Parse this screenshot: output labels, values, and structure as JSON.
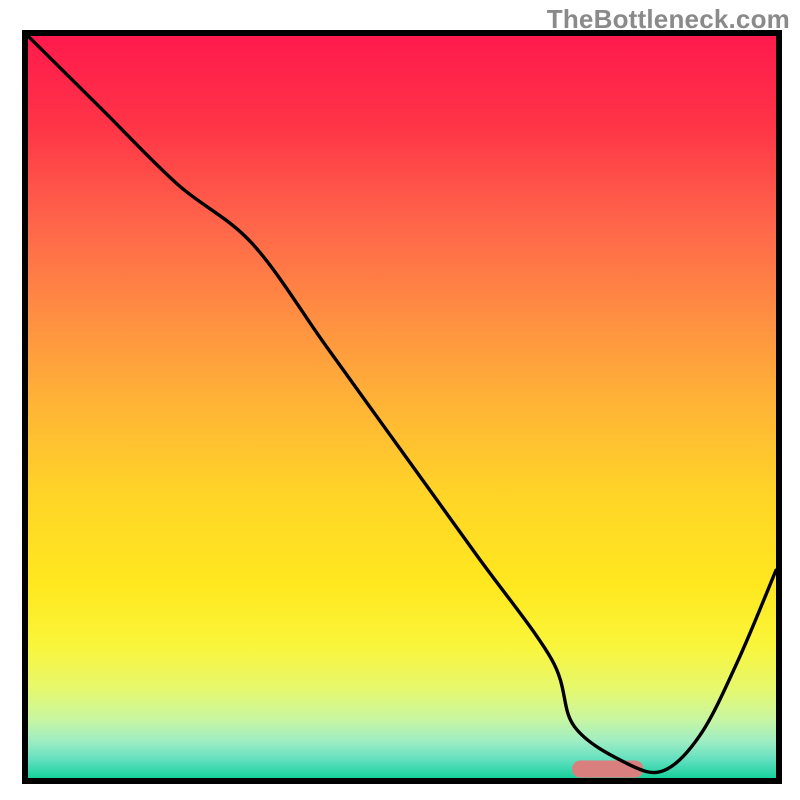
{
  "watermark": "TheBottleneck.com",
  "gradient": {
    "stops": [
      {
        "offset": 0.0,
        "color": "#ff1a4d"
      },
      {
        "offset": 0.12,
        "color": "#ff3447"
      },
      {
        "offset": 0.25,
        "color": "#ff644a"
      },
      {
        "offset": 0.38,
        "color": "#ff8f42"
      },
      {
        "offset": 0.5,
        "color": "#ffb536"
      },
      {
        "offset": 0.62,
        "color": "#ffd527"
      },
      {
        "offset": 0.74,
        "color": "#ffe81f"
      },
      {
        "offset": 0.82,
        "color": "#faf53a"
      },
      {
        "offset": 0.88,
        "color": "#e6f86d"
      },
      {
        "offset": 0.92,
        "color": "#c9f6a0"
      },
      {
        "offset": 0.95,
        "color": "#9fedc3"
      },
      {
        "offset": 0.975,
        "color": "#63e0c0"
      },
      {
        "offset": 1.0,
        "color": "#17d19b"
      }
    ]
  },
  "marker": {
    "x_frac": 0.775,
    "y_frac": 0.988,
    "width_frac": 0.095,
    "height_frac": 0.023,
    "rx": 8,
    "fill": "#d9807f"
  },
  "chart_data": {
    "type": "line",
    "title": "",
    "xlabel": "",
    "ylabel": "",
    "xlim": [
      0,
      100
    ],
    "ylim": [
      0,
      100
    ],
    "grid": false,
    "annotations": [
      "TheBottleneck.com"
    ],
    "x": [
      0,
      10,
      20,
      30,
      40,
      50,
      60,
      70,
      73,
      80,
      85,
      90,
      95,
      100
    ],
    "y": [
      100,
      90,
      80,
      72,
      58,
      44,
      30,
      16,
      7,
      2,
      1,
      6,
      16,
      28
    ],
    "optimum_range_x": [
      73,
      82
    ]
  }
}
